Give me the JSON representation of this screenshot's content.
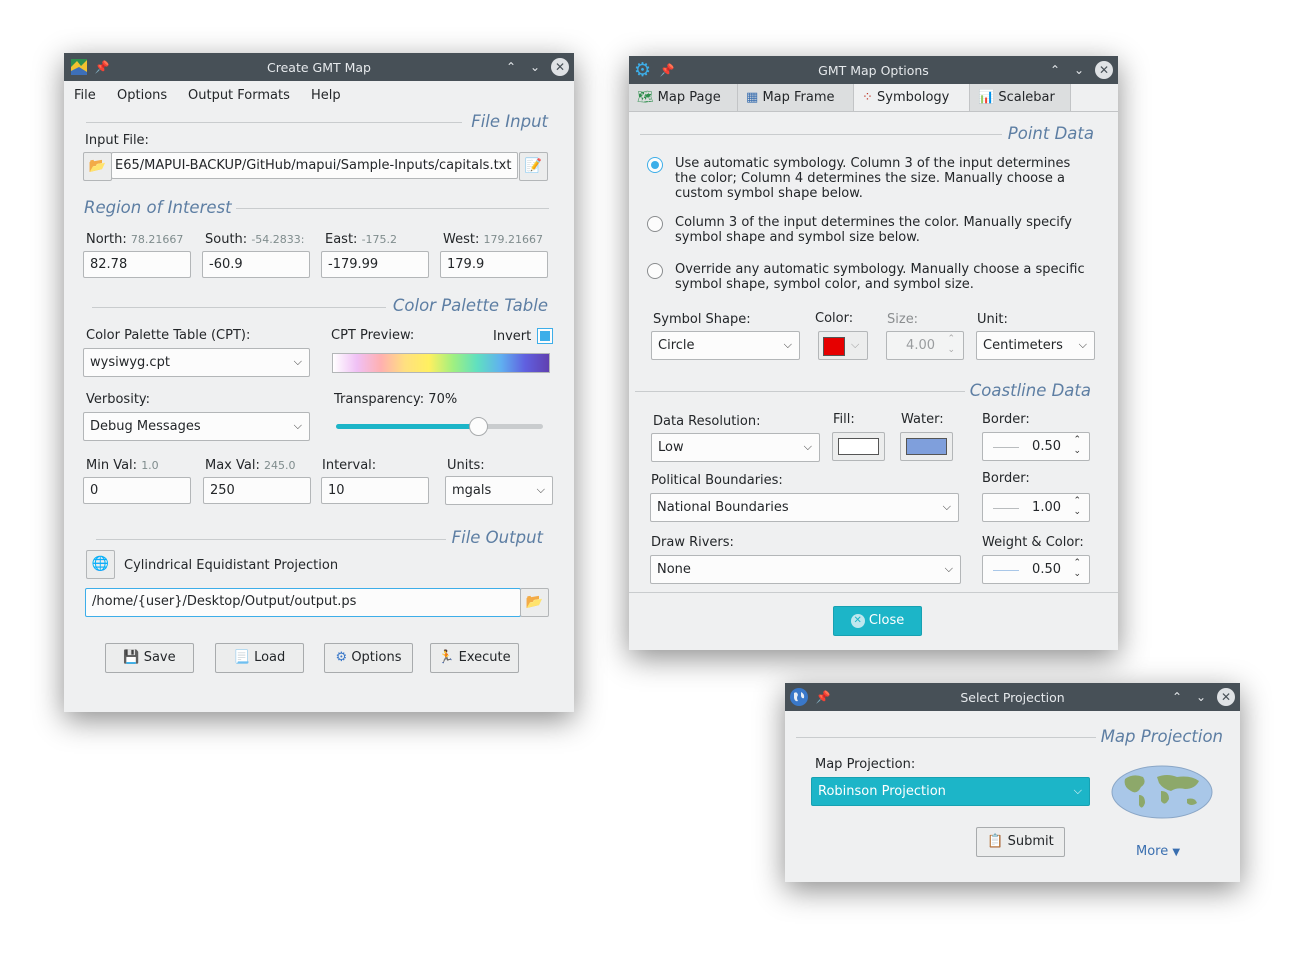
{
  "win1": {
    "title": "Create GMT Map",
    "menu": [
      "File",
      "Options",
      "Output Formats",
      "Help"
    ],
    "file_input_section": "File Input",
    "input_file_label": "Input File:",
    "input_file_value": "E65/MAPUI-BACKUP/GitHub/mapui/Sample-Inputs/capitals.txt",
    "roi_section": "Region of Interest",
    "north_label": "North:",
    "north_hint": "78.21667",
    "north_value": "82.78",
    "south_label": "South:",
    "south_hint": "-54.2833:",
    "south_value": "-60.9",
    "east_label": "East:",
    "east_hint": "-175.2",
    "east_value": "-179.99",
    "west_label": "West:",
    "west_hint": "179.21667",
    "west_value": "179.9",
    "cpt_section": "Color Palette Table",
    "cpt_label": "Color Palette Table (CPT):",
    "cpt_value": "wysiwyg.cpt",
    "cpt_preview_label": "CPT Preview:",
    "invert_label": "Invert",
    "verbosity_label": "Verbosity:",
    "verbosity_value": "Debug Messages",
    "transparency_label": "Transparency:",
    "transparency_value": "70%",
    "transparency_level": 0.7,
    "minval_label": "Min Val:",
    "minval_hint": "1.0",
    "minval_value": "0",
    "maxval_label": "Max Val:",
    "maxval_hint": "245.0",
    "maxval_value": "250",
    "interval_label": "Interval:",
    "interval_value": "10",
    "units_label": "Units:",
    "units_value": "mgals",
    "file_output_section": "File Output",
    "projection_name": "Cylindrical Equidistant Projection",
    "output_path": "/home/{user}/Desktop/Output/output.ps",
    "buttons": {
      "save": "Save",
      "load": "Load",
      "options": "Options",
      "execute": "Execute"
    }
  },
  "win2": {
    "title": "GMT Map Options",
    "tabs": [
      "Map Page",
      "Map Frame",
      "Symbology",
      "Scalebar"
    ],
    "point_section": "Point Data",
    "radio1": "Use automatic symbology. Column 3 of the input determines the color; Column 4 determines the size. Manually choose a custom symbol shape below.",
    "radio2": "Column 3 of the input determines the color. Manually specify symbol shape and symbol size below.",
    "radio3": "Override any automatic symbology. Manually choose a specific symbol shape, symbol color, and symbol size.",
    "shape_label": "Symbol Shape:",
    "shape_value": "Circle",
    "color_label": "Color:",
    "symbol_color": "#e60000",
    "size_label": "Size:",
    "size_value": "4.00",
    "unit_label": "Unit:",
    "unit_value": "Centimeters",
    "coast_section": "Coastline Data",
    "resolution_label": "Data Resolution:",
    "resolution_value": "Low",
    "fill_label": "Fill:",
    "fill_color": "#ffffff",
    "water_label": "Water:",
    "water_color": "#7f9fdc",
    "border_label": "Border:",
    "border1_value": "0.50",
    "political_label": "Political Boundaries:",
    "political_value": "National Boundaries",
    "border2_label": "Border:",
    "border2_value": "1.00",
    "rivers_label": "Draw Rivers:",
    "rivers_value": "None",
    "weight_label": "Weight & Color:",
    "weight_value": "0.50",
    "close": "Close"
  },
  "win3": {
    "title": "Select Projection",
    "section": "Map Projection",
    "projection_label": "Map Projection:",
    "projection_value": "Robinson Projection",
    "submit": "Submit",
    "more": "More"
  }
}
